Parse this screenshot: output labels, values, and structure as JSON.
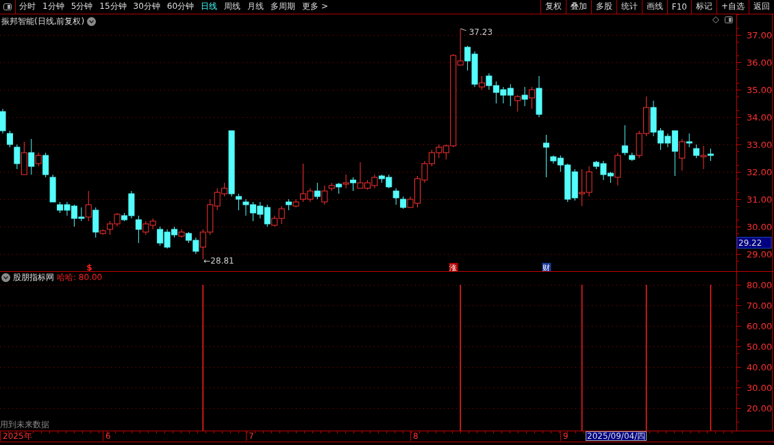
{
  "toolbar": {
    "periods": [
      {
        "label": "分时",
        "selected": false
      },
      {
        "label": "1分钟",
        "selected": false
      },
      {
        "label": "5分钟",
        "selected": false
      },
      {
        "label": "15分钟",
        "selected": false
      },
      {
        "label": "30分钟",
        "selected": false
      },
      {
        "label": "60分钟",
        "selected": false
      },
      {
        "label": "日线",
        "selected": true
      },
      {
        "label": "周线",
        "selected": false
      },
      {
        "label": "月线",
        "selected": false
      },
      {
        "label": "多周期",
        "selected": false
      },
      {
        "label": "更多 >",
        "selected": false
      }
    ],
    "actions": [
      "复权",
      "叠加",
      "多股",
      "统计",
      "画线",
      "F10",
      "标记",
      "+自选",
      "返回"
    ]
  },
  "main_chart": {
    "title": "振邦智能(日线,前复权)",
    "high_label": "37.23",
    "low_label": "←28.81",
    "cursor_price": "29.22",
    "markers": [
      {
        "label": "$",
        "kind": "text",
        "color": "#ff2020"
      },
      {
        "label": "涨",
        "kind": "tag",
        "color": "#b00000"
      },
      {
        "label": "财",
        "kind": "tag",
        "color": "#1c3c9c"
      }
    ],
    "chart_data": {
      "type": "candlestick",
      "grid": true,
      "ylim": [
        28.35,
        37.75
      ],
      "categories": [
        null,
        null,
        null,
        null,
        null,
        null,
        null,
        null,
        null,
        null,
        null,
        null,
        null,
        null,
        null,
        null,
        null,
        null,
        null,
        null,
        null,
        null,
        null,
        null,
        null,
        null,
        null,
        null,
        null,
        null,
        null,
        null,
        null,
        null,
        null,
        null,
        null,
        null,
        null,
        null,
        null,
        null,
        null,
        null,
        null,
        null,
        null,
        null,
        null,
        null,
        null,
        null,
        null,
        null,
        null,
        null,
        null,
        null,
        null,
        null,
        null,
        null,
        null,
        null,
        null,
        null,
        null,
        null,
        null,
        null,
        null,
        null,
        null,
        null,
        null,
        null,
        null,
        null,
        null,
        null,
        null,
        null,
        null,
        null,
        null,
        null,
        null,
        null,
        null,
        null,
        null,
        null,
        null,
        null,
        null,
        null,
        null,
        null,
        null,
        null
      ],
      "yticks": [
        {
          "value": 37,
          "label": "37.00"
        },
        {
          "value": 36,
          "label": "36.00"
        },
        {
          "value": 35,
          "label": "35.00"
        },
        {
          "value": 34,
          "label": "34.00"
        },
        {
          "value": 33,
          "label": "33.00"
        },
        {
          "value": 32,
          "label": "32.00"
        },
        {
          "value": 31,
          "label": "31.00"
        },
        {
          "value": 30,
          "label": "30.00"
        },
        {
          "value": 29,
          "label": "29.00"
        }
      ],
      "ohlc": [
        [
          34.2,
          34.3,
          33.4,
          33.5
        ],
        [
          33.4,
          33.5,
          32.9,
          33.0
        ],
        [
          32.9,
          33.0,
          32.1,
          32.3
        ],
        [
          31.9,
          33.1,
          31.9,
          32.7
        ],
        [
          32.7,
          33.2,
          31.9,
          32.2
        ],
        [
          32.3,
          32.7,
          32.2,
          32.6
        ],
        [
          32.6,
          32.7,
          31.8,
          31.9
        ],
        [
          31.8,
          31.9,
          30.9,
          30.9
        ],
        [
          30.8,
          30.9,
          30.5,
          30.6
        ],
        [
          30.8,
          30.9,
          30.4,
          30.6
        ],
        [
          30.75,
          30.8,
          30.0,
          30.3
        ],
        [
          30.35,
          30.7,
          30.2,
          30.3
        ],
        [
          30.35,
          31.3,
          30.2,
          30.8
        ],
        [
          30.6,
          30.7,
          29.6,
          29.8
        ],
        [
          29.75,
          29.9,
          29.7,
          29.85
        ],
        [
          29.9,
          30.2,
          29.7,
          30.1
        ],
        [
          30.1,
          30.5,
          30.0,
          30.45
        ],
        [
          30.4,
          30.5,
          30.2,
          30.25
        ],
        [
          31.2,
          31.3,
          30.3,
          30.4
        ],
        [
          30.25,
          30.4,
          29.4,
          29.9
        ],
        [
          29.8,
          30.2,
          29.7,
          30.1
        ],
        [
          30.05,
          30.3,
          29.9,
          30.2
        ],
        [
          29.9,
          30.0,
          29.3,
          29.4
        ],
        [
          29.8,
          29.9,
          29.2,
          29.25
        ],
        [
          29.9,
          30.0,
          29.6,
          29.7
        ],
        [
          29.65,
          29.9,
          29.6,
          29.8
        ],
        [
          29.75,
          29.8,
          29.4,
          29.5
        ],
        [
          29.5,
          29.6,
          29.0,
          29.1
        ],
        [
          29.25,
          29.9,
          28.81,
          29.8
        ],
        [
          29.8,
          31.0,
          29.7,
          30.8
        ],
        [
          30.75,
          31.4,
          30.6,
          31.25
        ],
        [
          31.2,
          31.6,
          31.1,
          31.4
        ],
        [
          33.5,
          33.5,
          31.1,
          31.2
        ],
        [
          31.1,
          31.2,
          30.6,
          31.0
        ],
        [
          30.9,
          31.0,
          30.4,
          30.8
        ],
        [
          30.8,
          30.9,
          30.2,
          30.5
        ],
        [
          30.75,
          30.9,
          30.3,
          30.45
        ],
        [
          30.7,
          30.8,
          30.0,
          30.1
        ],
        [
          30.05,
          30.4,
          30.0,
          30.3
        ],
        [
          30.3,
          30.75,
          30.1,
          30.65
        ],
        [
          30.9,
          31.0,
          30.6,
          30.8
        ],
        [
          30.75,
          31.0,
          30.7,
          30.9
        ],
        [
          31.0,
          32.3,
          30.9,
          31.2
        ],
        [
          31.0,
          31.4,
          30.9,
          31.3
        ],
        [
          31.3,
          31.6,
          31.0,
          31.1
        ],
        [
          30.9,
          31.5,
          30.8,
          31.3
        ],
        [
          31.4,
          31.6,
          31.3,
          31.5
        ],
        [
          31.55,
          31.6,
          31.2,
          31.45
        ],
        [
          31.55,
          31.9,
          31.4,
          31.6
        ],
        [
          31.7,
          31.8,
          31.3,
          31.6
        ],
        [
          31.4,
          32.35,
          31.4,
          31.6
        ],
        [
          31.4,
          31.7,
          31.35,
          31.6
        ],
        [
          31.5,
          31.9,
          31.4,
          31.8
        ],
        [
          31.85,
          31.9,
          31.6,
          31.75
        ],
        [
          31.8,
          31.9,
          31.4,
          31.45
        ],
        [
          31.3,
          31.4,
          30.8,
          31.05
        ],
        [
          31.0,
          31.1,
          30.65,
          30.7
        ],
        [
          30.7,
          31.1,
          30.7,
          31.0
        ],
        [
          30.85,
          31.85,
          30.7,
          31.75
        ],
        [
          31.7,
          32.4,
          31.6,
          32.3
        ],
        [
          32.3,
          32.8,
          32.2,
          32.7
        ],
        [
          32.7,
          33.0,
          32.5,
          32.9
        ],
        [
          32.7,
          33.0,
          32.45,
          32.95
        ],
        [
          32.95,
          36.3,
          32.9,
          36.25
        ],
        [
          35.9,
          37.23,
          35.9,
          36.05
        ],
        [
          36.55,
          36.6,
          35.7,
          36.05
        ],
        [
          36.3,
          36.4,
          35.1,
          35.2
        ],
        [
          35.1,
          35.5,
          35.0,
          35.25
        ],
        [
          35.5,
          35.6,
          35.0,
          35.15
        ],
        [
          35.15,
          35.3,
          34.5,
          34.9
        ],
        [
          35.0,
          35.1,
          34.5,
          34.8
        ],
        [
          35.05,
          35.2,
          34.4,
          34.8
        ],
        [
          34.6,
          34.8,
          34.2,
          34.75
        ],
        [
          34.8,
          35.1,
          34.4,
          34.65
        ],
        [
          34.7,
          35.1,
          34.3,
          35.0
        ],
        [
          35.05,
          35.5,
          34.0,
          34.1
        ],
        [
          33.05,
          33.35,
          31.8,
          32.9
        ],
        [
          32.55,
          32.6,
          32.3,
          32.4
        ],
        [
          32.5,
          32.6,
          32.0,
          32.25
        ],
        [
          32.25,
          32.3,
          30.9,
          31.0
        ],
        [
          32.0,
          32.1,
          30.95,
          31.05
        ],
        [
          31.2,
          32.1,
          30.75,
          31.25
        ],
        [
          31.25,
          32.2,
          31.1,
          32.0
        ],
        [
          32.35,
          32.4,
          32.1,
          32.2
        ],
        [
          32.3,
          32.4,
          31.7,
          31.9
        ],
        [
          31.95,
          32.0,
          31.6,
          31.85
        ],
        [
          31.8,
          32.7,
          31.5,
          32.6
        ],
        [
          32.95,
          33.7,
          32.6,
          32.7
        ],
        [
          32.6,
          32.7,
          32.4,
          32.45
        ],
        [
          32.6,
          33.5,
          32.5,
          33.4
        ],
        [
          33.4,
          34.75,
          33.3,
          34.35
        ],
        [
          34.35,
          34.6,
          33.3,
          33.45
        ],
        [
          33.5,
          33.6,
          32.8,
          33.05
        ],
        [
          33.3,
          33.4,
          32.9,
          33.05
        ],
        [
          33.5,
          33.5,
          31.85,
          32.75
        ],
        [
          32.5,
          33.2,
          32.05,
          33.1
        ],
        [
          33.1,
          33.4,
          32.9,
          33.05
        ],
        [
          32.85,
          33.0,
          32.5,
          32.6
        ],
        [
          32.55,
          32.95,
          32.1,
          32.6
        ],
        [
          32.65,
          32.85,
          32.4,
          32.6
        ]
      ]
    }
  },
  "indicator": {
    "name": "股朋指标网",
    "reading": "哈哈: 80.00",
    "note": "用到未来数据",
    "chart_data": {
      "type": "bar",
      "grid": true,
      "ylim": [
        9,
        86.67
      ],
      "categories": [
        null,
        null,
        null,
        null,
        null,
        null,
        null,
        null,
        null,
        null,
        null,
        null,
        null,
        null,
        null,
        null,
        null,
        null,
        null,
        null,
        null,
        null,
        null,
        null,
        null,
        null,
        null,
        null,
        null,
        null,
        null,
        null,
        null,
        null,
        null,
        null,
        null,
        null,
        null,
        null,
        null,
        null,
        null,
        null,
        null,
        null,
        null,
        null,
        null,
        null,
        null,
        null,
        null,
        null,
        null,
        null,
        null,
        null,
        null,
        null,
        null,
        null,
        null,
        null,
        null,
        null,
        null,
        null,
        null,
        null,
        null,
        null,
        null,
        null,
        null,
        null,
        null,
        null,
        null,
        null,
        null,
        null,
        null,
        null,
        null,
        null,
        null,
        null,
        null,
        null,
        null,
        null,
        null,
        null,
        null,
        null,
        null,
        null,
        null,
        null
      ],
      "yticks": [
        {
          "value": 80,
          "label": "80.00"
        },
        {
          "value": 70,
          "label": "70.00"
        },
        {
          "value": 60,
          "label": "60.00"
        },
        {
          "value": 50,
          "label": "50.00"
        },
        {
          "value": 40,
          "label": "40.00"
        },
        {
          "value": 30,
          "label": "30.00"
        },
        {
          "value": 20,
          "label": "20.00"
        }
      ],
      "values": [
        null,
        null,
        null,
        null,
        null,
        null,
        null,
        null,
        null,
        null,
        null,
        null,
        null,
        null,
        null,
        null,
        null,
        null,
        null,
        null,
        null,
        null,
        null,
        null,
        null,
        null,
        null,
        null,
        80,
        null,
        null,
        null,
        null,
        null,
        null,
        null,
        null,
        null,
        null,
        null,
        null,
        null,
        null,
        null,
        null,
        null,
        null,
        null,
        null,
        null,
        null,
        null,
        null,
        null,
        null,
        null,
        null,
        null,
        null,
        null,
        null,
        null,
        null,
        null,
        80,
        null,
        null,
        null,
        null,
        null,
        null,
        null,
        null,
        null,
        null,
        null,
        null,
        null,
        null,
        null,
        null,
        80,
        null,
        null,
        null,
        null,
        null,
        null,
        null,
        null,
        80,
        null,
        null,
        null,
        null,
        null,
        null,
        null,
        null,
        80
      ]
    }
  },
  "date_axis": {
    "labels": [
      "2025年",
      "6",
      "7",
      "8",
      "9"
    ],
    "cursor_date": "2025/09/04/四"
  }
}
